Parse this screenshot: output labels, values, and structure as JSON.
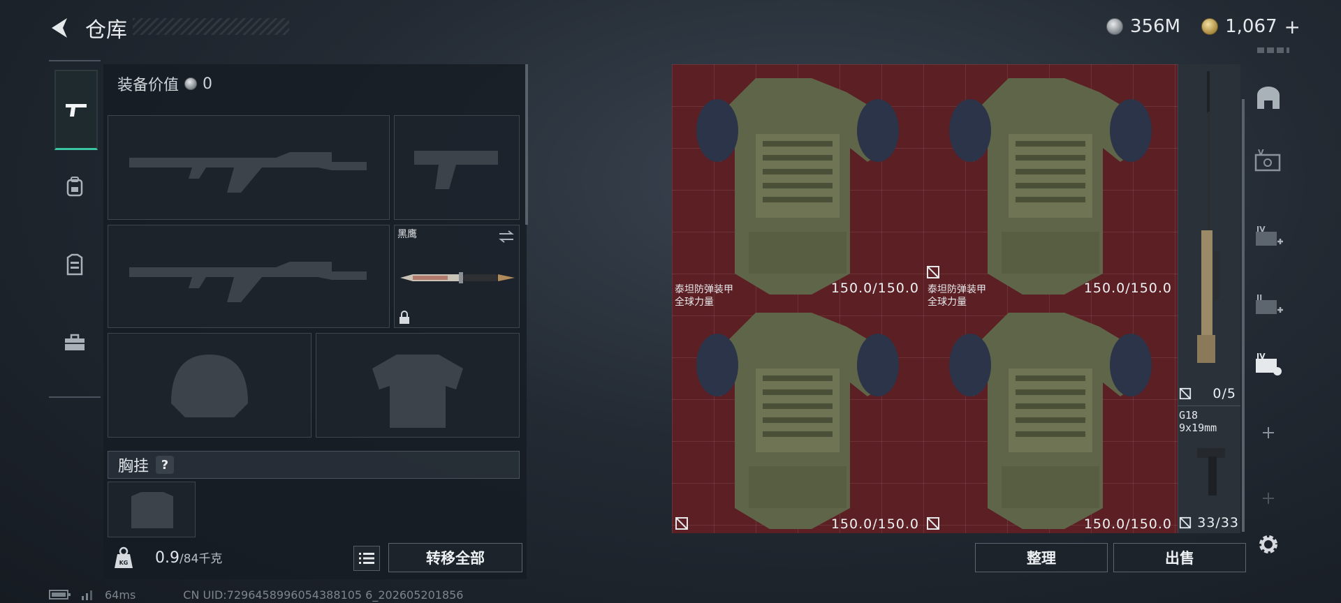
{
  "header": {
    "title": "仓库",
    "silver_amount": "356M",
    "gold_amount": "1,067",
    "add_symbol": "+"
  },
  "left_tabs": [
    "pistol-icon",
    "backpack-icon",
    "vest-icon",
    "toolbox-icon"
  ],
  "equipment": {
    "value_label": "装备价值",
    "value_amount": "0",
    "knife_name": "黑鹰",
    "chest_rig_label": "胸挂",
    "chest_rig_help": "?",
    "weight_current": "0.9",
    "weight_max": "/84千克",
    "transfer_all_label": "转移全部"
  },
  "stash": {
    "armors": [
      {
        "name_line1": "",
        "name_line2": "",
        "durability": "150.0/150.0"
      },
      {
        "name_line1": "",
        "name_line2": "",
        "durability": "150.0/150.0"
      },
      {
        "name_line1": "泰坦防弹装甲",
        "name_line2": "全球力量",
        "durability": "150.0/150.0"
      },
      {
        "name_line1": "泰坦防弹装甲",
        "name_line2": "全球力量",
        "durability": "150.0/150.0"
      }
    ],
    "rifle_ammo": "0/5",
    "g18_name": "G18",
    "g18_caliber": "9x19mm",
    "g18_ammo": "33/33"
  },
  "actions": {
    "sort_label": "整理",
    "sell_label": "出售"
  },
  "status": {
    "ping": "64ms",
    "uid": "CN UID:7296458996054388105 6_202605201856"
  },
  "colors": {
    "accent": "#3ac4a0",
    "grid_red": "#5c1f24"
  }
}
